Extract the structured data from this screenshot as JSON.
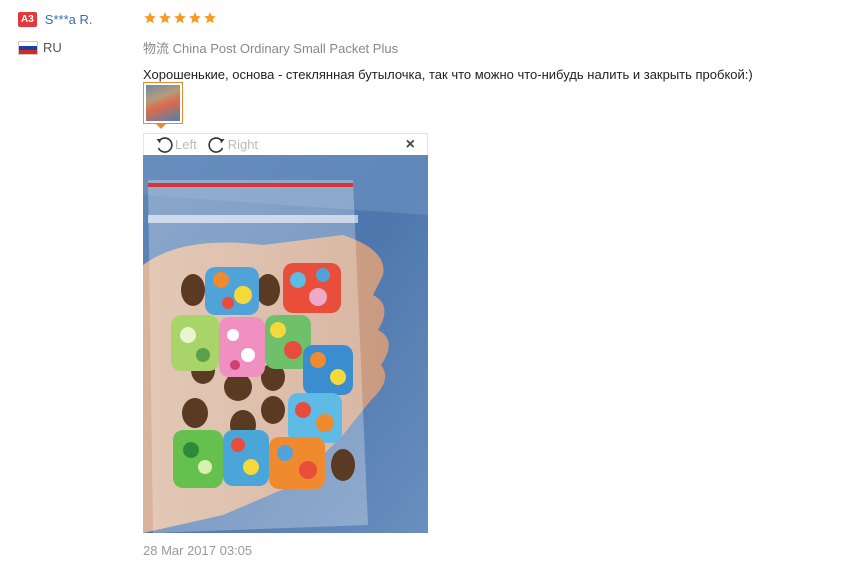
{
  "user": {
    "level_badge": "A3",
    "name": "S***a R.",
    "country_code": "RU",
    "flag_colors": [
      "#ffffff",
      "#1c3fa6",
      "#d52b1e"
    ]
  },
  "review": {
    "rating": 5,
    "star_color": "#f59a23",
    "shipping_prefix": "物流",
    "shipping_method": "China Post Ordinary Small Packet Plus",
    "text": "Хорошенькие, основа - стеклянная бутылочка, так что можно что-нибудь налить и закрыть пробкой:)",
    "date": "28 Mar 2017 03:05"
  },
  "viewer": {
    "rotate_left_label": "Left",
    "rotate_right_label": "Right",
    "close_label": "×"
  },
  "accent_color": "#e88a2e",
  "link_color": "#3a6bb0"
}
